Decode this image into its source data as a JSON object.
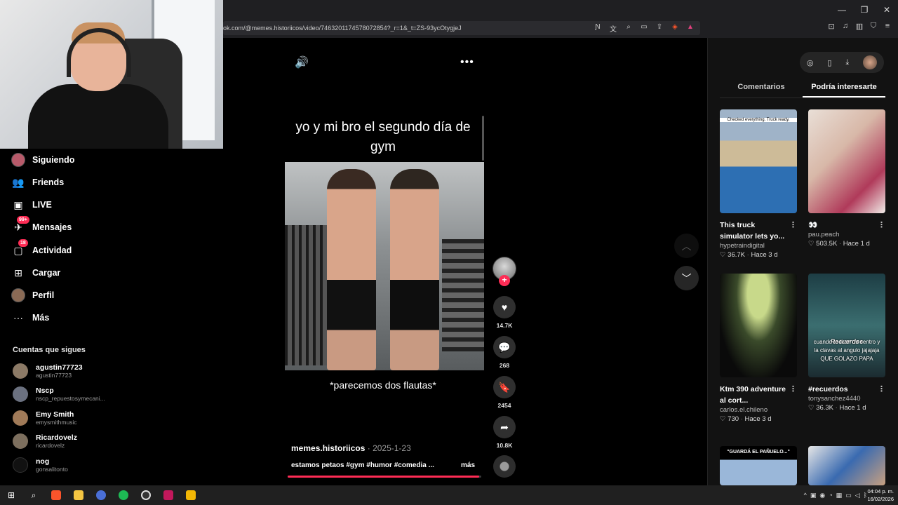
{
  "browser": {
    "url": "ok.com/@memes.historiicos/video/7463201174578072854?_r=1&_t=ZS-93ycOtygjeJ",
    "window_controls": [
      "—",
      "❐",
      "✕"
    ]
  },
  "sidebar": {
    "nav": [
      {
        "label": "Siguiendo",
        "icon": "following-avatar-icon"
      },
      {
        "label": "Friends",
        "icon": "friends-icon"
      },
      {
        "label": "LIVE",
        "icon": "live-icon"
      },
      {
        "label": "Mensajes",
        "icon": "messages-icon",
        "badge": "99+"
      },
      {
        "label": "Actividad",
        "icon": "activity-icon",
        "badge": "18"
      },
      {
        "label": "Cargar",
        "icon": "upload-icon"
      },
      {
        "label": "Perfil",
        "icon": "profile-avatar-icon"
      },
      {
        "label": "Más",
        "icon": "more-dots-icon"
      }
    ],
    "following_title": "Cuentas que sigues",
    "accounts": [
      {
        "name": "agustin77723",
        "handle": "agustin77723"
      },
      {
        "name": "Nscp",
        "handle": "nscp_repuestosymecani..."
      },
      {
        "name": "Emy Smith",
        "handle": "emysmithmusic"
      },
      {
        "name": "Ricardovelz",
        "handle": "ricardovelz"
      },
      {
        "name": "nog",
        "handle": "gonsalitonto"
      }
    ]
  },
  "video": {
    "caption_top": "yo y mi bro el segundo día de gym",
    "caption_bottom": "*parecemos dos flautas*",
    "author": "memes.historiicos",
    "date": "2025-1-23",
    "description": "estamos petaos #gym #humor #comedia ...",
    "more_label": "más",
    "progress": 0.99
  },
  "actions": {
    "likes": "14.7K",
    "comments": "268",
    "saves": "2454",
    "shares": "10.8K"
  },
  "right_panel": {
    "tabs": [
      {
        "label": "Comentarios",
        "active": false
      },
      {
        "label": "Podría interesarte",
        "active": true
      }
    ],
    "cards": [
      {
        "title": "This truck simulator lets yo...",
        "user": "hypetraindigital",
        "likes": "36.7K",
        "age": "Hace 3 d",
        "overlay": "Checked everything. Truck ready."
      },
      {
        "title": "👀",
        "user": "pau.peach",
        "likes": "503.5K",
        "age": "Hace 1 d",
        "overlay": ""
      },
      {
        "title": "Ktm 390 adventure al cort...",
        "user": "carlos.el.chileno",
        "likes": "730",
        "age": "Hace 3 d",
        "overlay": ""
      },
      {
        "title": "#recuerdos",
        "user": "tonysanchez4440",
        "likes": "36.3K",
        "age": "Hace 1 d",
        "overlay": "cuando te tiran un centro y la clavas al angulo jajajaja QUE GOLAZO PAPA",
        "overlay_title": "Recuerdos"
      },
      {
        "title": "",
        "user": "",
        "likes": "",
        "age": "",
        "overlay": "\"GUARDÁ EL PAÑUELO...\""
      },
      {
        "title": "",
        "user": "",
        "likes": "",
        "age": "",
        "overlay": ""
      }
    ]
  },
  "taskbar": {
    "time": "04:04 p. m.",
    "date": "16/02/2026"
  },
  "colors": {
    "accent": "#fe2c55",
    "panel": "#121212",
    "taskbar": "#202020"
  }
}
